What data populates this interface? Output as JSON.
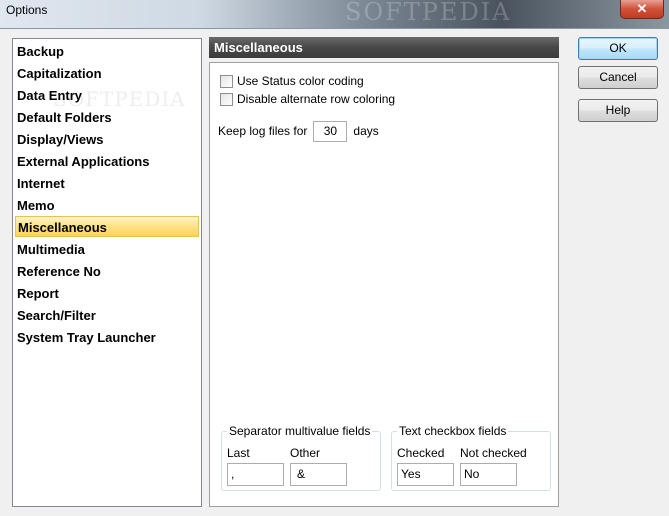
{
  "window": {
    "title": "Options",
    "watermark": "SOFTPEDIA",
    "close_glyph": "✕"
  },
  "sidebar": {
    "watermark": "SOFTPEDIA",
    "items": [
      {
        "label": "Backup"
      },
      {
        "label": "Capitalization"
      },
      {
        "label": "Data Entry"
      },
      {
        "label": "Default Folders"
      },
      {
        "label": "Display/Views"
      },
      {
        "label": "External Applications"
      },
      {
        "label": "Internet"
      },
      {
        "label": "Memo"
      },
      {
        "label": "Miscellaneous",
        "selected": true
      },
      {
        "label": "Multimedia"
      },
      {
        "label": "Reference No"
      },
      {
        "label": "Report"
      },
      {
        "label": "Search/Filter"
      },
      {
        "label": "System Tray Launcher"
      }
    ]
  },
  "panel": {
    "header": "Miscellaneous",
    "checkboxes": [
      {
        "label": "Use Status color coding",
        "checked": false
      },
      {
        "label": "Disable alternate row coloring",
        "checked": false
      }
    ],
    "log": {
      "prefix": "Keep log files for",
      "value": "30",
      "suffix": "days"
    },
    "separator_group": {
      "title": "Separator multivalue fields",
      "last_label": "Last",
      "last_value": ",",
      "other_label": "Other",
      "other_value": "&"
    },
    "text_checkbox_group": {
      "title": "Text checkbox fields",
      "checked_label": "Checked",
      "checked_value": "Yes",
      "not_checked_label": "Not checked",
      "not_checked_value": "No"
    }
  },
  "buttons": {
    "ok": "OK",
    "cancel": "Cancel",
    "help": "Help"
  },
  "colors": {
    "selection": "#ffd35a",
    "header_bg": "#474747",
    "default_button": "#3c7fb1"
  }
}
